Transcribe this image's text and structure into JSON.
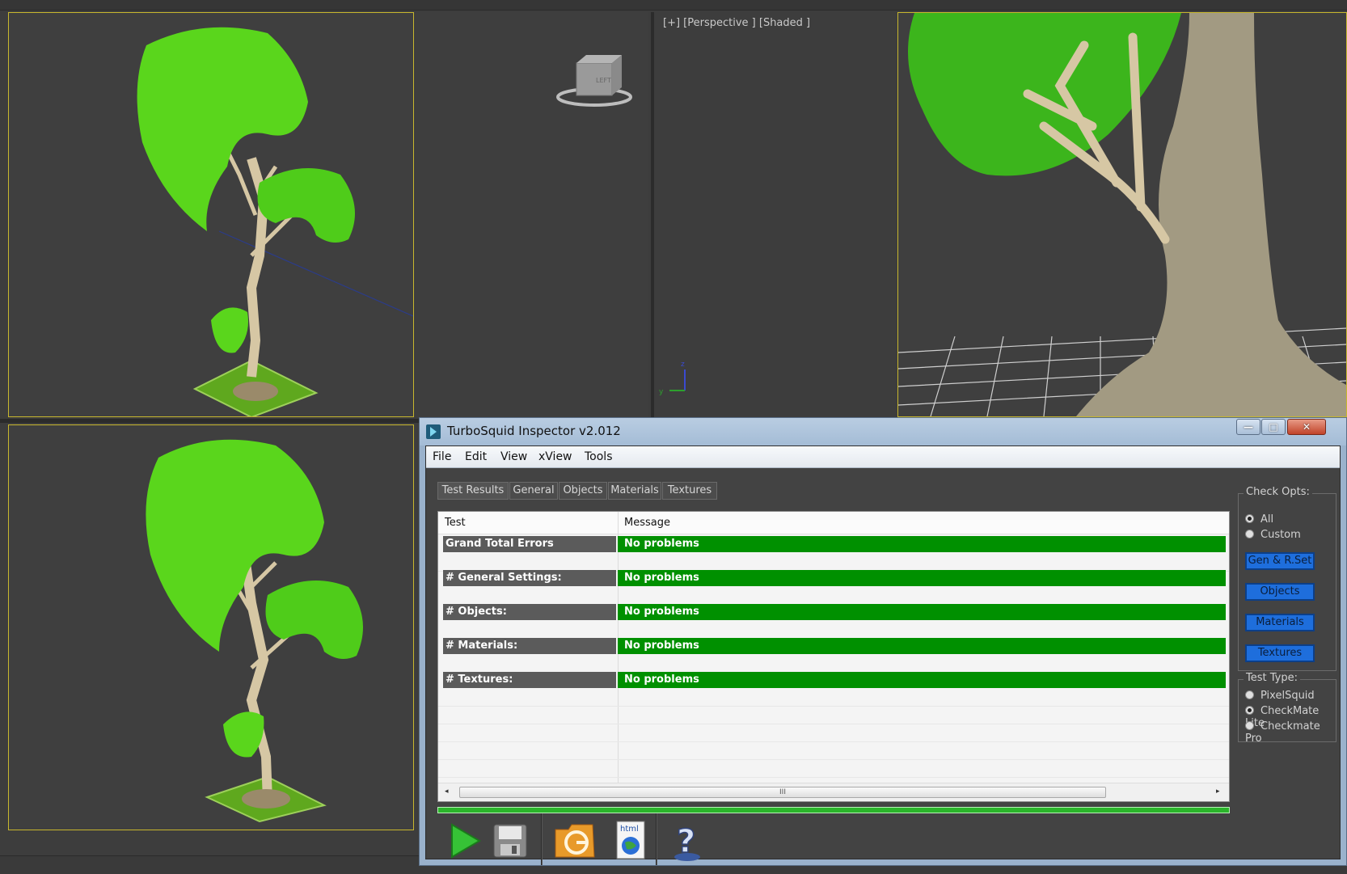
{
  "viewports": {
    "perspective_label": "[+] [Perspective ] [Shaded ]",
    "viewcube_text": "LEFT"
  },
  "window": {
    "title": "TurboSquid Inspector v2.012",
    "controls": {
      "minimize": "—",
      "maximize": "□",
      "close": "✕"
    }
  },
  "menu": [
    "File",
    "Edit",
    "View",
    "xView",
    "Tools"
  ],
  "tabs": [
    "Test Results",
    "General",
    "Objects",
    "Materials",
    "Textures"
  ],
  "selected_tab": "Test Results",
  "grid": {
    "headers": [
      "Test",
      "Message"
    ],
    "rows": [
      {
        "test": "Grand Total Errors",
        "message": "No problems"
      },
      {
        "test": "# General Settings:",
        "message": "No problems"
      },
      {
        "test": "# Objects:",
        "message": "No problems"
      },
      {
        "test": "# Materials:",
        "message": "No problems"
      },
      {
        "test": "# Textures:",
        "message": "No problems"
      }
    ],
    "scroll_left": "◂",
    "scroll_right": "▸",
    "scroll_thumb": "III"
  },
  "toolbar": {
    "run": "play-icon",
    "save": "save-icon",
    "open": "folder-icon",
    "html": "html",
    "help": "?"
  },
  "check_opts": {
    "title": "Check Opts:",
    "options": [
      "All",
      "Custom"
    ],
    "selected": "All",
    "buttons": [
      "Gen & R.Set",
      "Objects",
      "Materials",
      "Textures"
    ]
  },
  "test_type": {
    "title": "Test Type:",
    "options": [
      "PixelSquid",
      "CheckMate Lite",
      "Checkmate Pro"
    ],
    "selected": "CheckMate Lite"
  },
  "colors": {
    "ok_green": "#009000",
    "row_gray": "#5b5b5b",
    "accent_blue": "#1e6edc",
    "viewport_border": "#c8b72e",
    "leaf_green": "#5ad61c",
    "trunk": "#d6c7a4"
  }
}
